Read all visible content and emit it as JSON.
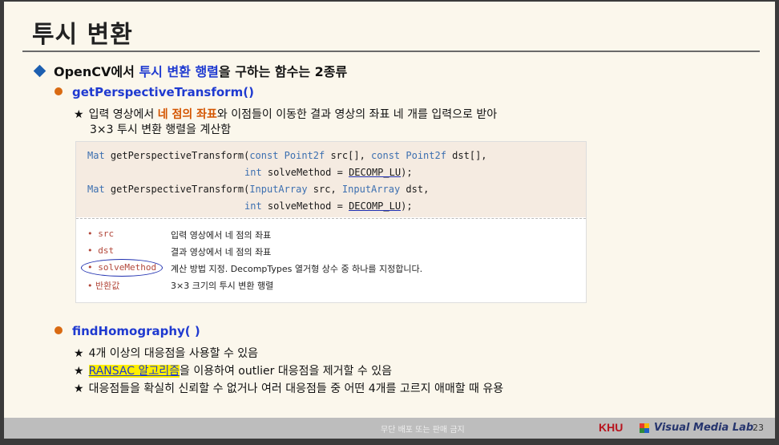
{
  "slide": {
    "title": "투시 변환",
    "main_point": {
      "pre": "OpenCV에서 ",
      "highlight": "투시 변환 행렬",
      "post": "을 구하는 함수는 2종류"
    },
    "sections": [
      {
        "heading": "getPerspectiveTransform()",
        "lines": [
          {
            "pre": "입력 영상에서 ",
            "emph": "네 점의 좌표",
            "post": "와 이점들이 이동한 결과 영상의 좌표 네 개를 입력으로 받아"
          },
          {
            "text": "3×3 투시 변환 행렬을 계산함"
          }
        ]
      },
      {
        "heading": "findHomography( )",
        "lines": [
          {
            "text": "4개 이상의 대응점을 사용할 수 있음"
          },
          {
            "hl": "RANSAC 알고리즘",
            "post": "을 이용하여 outlier 대응점을 제거할 수 있음"
          },
          {
            "text": "대응점들을 확실히 신뢰할 수 없거나 여러 대응점들 중 어떤 4개를 고르지 애매할 때 유용"
          }
        ]
      }
    ],
    "star_glyph": "★"
  },
  "code": {
    "l1_type": "Mat",
    "l1_fn": " getPerspectiveTransform(",
    "l1_a": "const Point2f",
    "l1_b": " src[], ",
    "l1_c": "const Point2f",
    "l1_d": " dst[],",
    "l2_a": "int",
    "l2_b": " solveMethod = ",
    "l2_c": "DECOMP_LU",
    "l2_d": ");",
    "l3_type": "Mat",
    "l3_fn": " getPerspectiveTransform(",
    "l3_a": "InputArray",
    "l3_b": " src, ",
    "l3_c": "InputArray",
    "l3_d": " dst,",
    "l4_a": "int",
    "l4_b": " solveMethod = ",
    "l4_c": "DECOMP_LU",
    "l4_d": ");"
  },
  "params": [
    {
      "name": "• src",
      "desc": "입력 영상에서 네 점의 좌표"
    },
    {
      "name": "• dst",
      "desc": "결과 영상에서 네 점의 좌표"
    },
    {
      "name": "• solveMethod",
      "desc": "계산 방법 지정. DecompTypes 열거형 상수 중 하나를 지정합니다."
    },
    {
      "name": "• 반환값",
      "desc": "3×3 크기의 투시 변환 행렬"
    }
  ],
  "footer": {
    "notice": "무단 배포 또는 판매 금지",
    "univ": "KHU",
    "lab": "Visual Media Lab",
    "page": "23"
  },
  "colors": {
    "accent_blue": "#1f3ad0",
    "accent_orange": "#d45500",
    "highlight": "#ffef00",
    "diamond": "#1d5fb0",
    "bullet_dot": "#d96a12"
  },
  "icons": {
    "main_bullet": "diamond-icon",
    "section_bullet": "circle-bullet-icon",
    "line_bullet": "star-icon"
  }
}
